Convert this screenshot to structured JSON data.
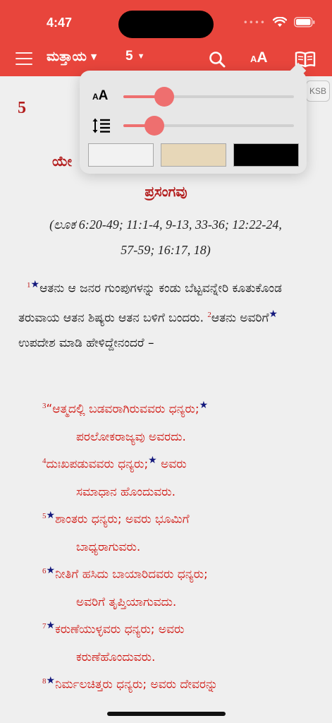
{
  "status_bar": {
    "time": "4:47",
    "signal": "••••"
  },
  "nav": {
    "menu_icon": "hamburger-icon",
    "book": "ಮತ್ತಾಯ",
    "book_caret": "▼",
    "chapter": "5",
    "chapter_caret": "▼",
    "search_icon": "search-icon",
    "text_size_small": "A",
    "text_size_big": "A",
    "book_icon": "open-book-icon"
  },
  "display_settings": {
    "font_size_icon_small": "A",
    "font_size_icon_big": "A",
    "font_size_level": 0.24,
    "line_spacing_icon": "line-spacing-icon",
    "line_spacing_level": 0.18,
    "themes": [
      {
        "name": "light",
        "color": "#f2f2f2"
      },
      {
        "name": "sepia",
        "color": "#e7d7b8"
      },
      {
        "name": "dark",
        "color": "#000000"
      }
    ]
  },
  "content": {
    "chapter_number": "5",
    "version_badge": "KSB",
    "heading_visible_start": "ಯೇ",
    "heading_line2": "ಪ್ರಸಂಗವು",
    "cross_reference_line1": "(ಲೂಕ 6:20-49; 11:1-4, 9-13, 33-36; 12:22-24,",
    "cross_reference_line2": "57-59; 16:17, 18)",
    "paragraph": {
      "v1_num": "1",
      "v1_text": "ಆತನು ಆ ಜನರ ಗುಂಪುಗಳನ್ನು ಕಂಡು ಬೆಟ್ಟವನ್ನೇರಿ ಕೂತುಕೊಂಡ ತರುವಾಯ ಆತನ ಶಿಷ್ಯರು ಆತನ ಬಳಿಗೆ ಬಂದರು.",
      "v2_num": "2",
      "v2_text": "ಆತನು ಅವರಿಗೆ",
      "v2_text_cont": "ಉಪದೇಶ ಮಾಡಿ ಹೇಳಿದ್ದೇನಂದರೆ –"
    },
    "beatitudes": [
      {
        "num": "3",
        "line1": "“ಆತ್ಮದಲ್ಲಿ ಬಡವರಾಗಿರುವವರು ಧನ್ಯರು;",
        "line2": "ಪರಲೋಕರಾಜ್ಯವು ಅವರದು."
      },
      {
        "num": "4",
        "line1": "ದುಃಖಪಡುವವರು ಧನ್ಯರು;",
        "line1b": " ಅವರು",
        "line2": "ಸಮಾಧಾನ ಹೊಂದುವರು."
      },
      {
        "num": "5",
        "line1": "ಶಾಂತರು ಧನ್ಯರು; ಅವರು ಭೂಮಿಗೆ",
        "line2": "ಬಾಧ್ಯರಾಗುವರು."
      },
      {
        "num": "6",
        "line1": "ನೀತಿಗೆ ಹಸಿದು ಬಾಯಾರಿದವರು ಧನ್ಯರು;",
        "line2": "ಅವರಿಗೆ ತೃಪ್ತಿಯಾಗುವದು."
      },
      {
        "num": "7",
        "line1": "ಕರುಣೆಯುಳ್ಳವರು ಧನ್ಯರು; ಅವರು",
        "line2": "ಕರುಣೆಹೊಂದುವರು."
      },
      {
        "num": "8",
        "line1": "ನಿರ್ಮಲಚಿತ್ತರು ಧನ್ಯರು; ಅವರು ದೇವರನ್ನು"
      }
    ],
    "star_symbol": "★"
  },
  "colors": {
    "header": "#e8453c",
    "verse_red": "#d0150f",
    "star": "#14197d",
    "slider": "#ee6f6f"
  }
}
